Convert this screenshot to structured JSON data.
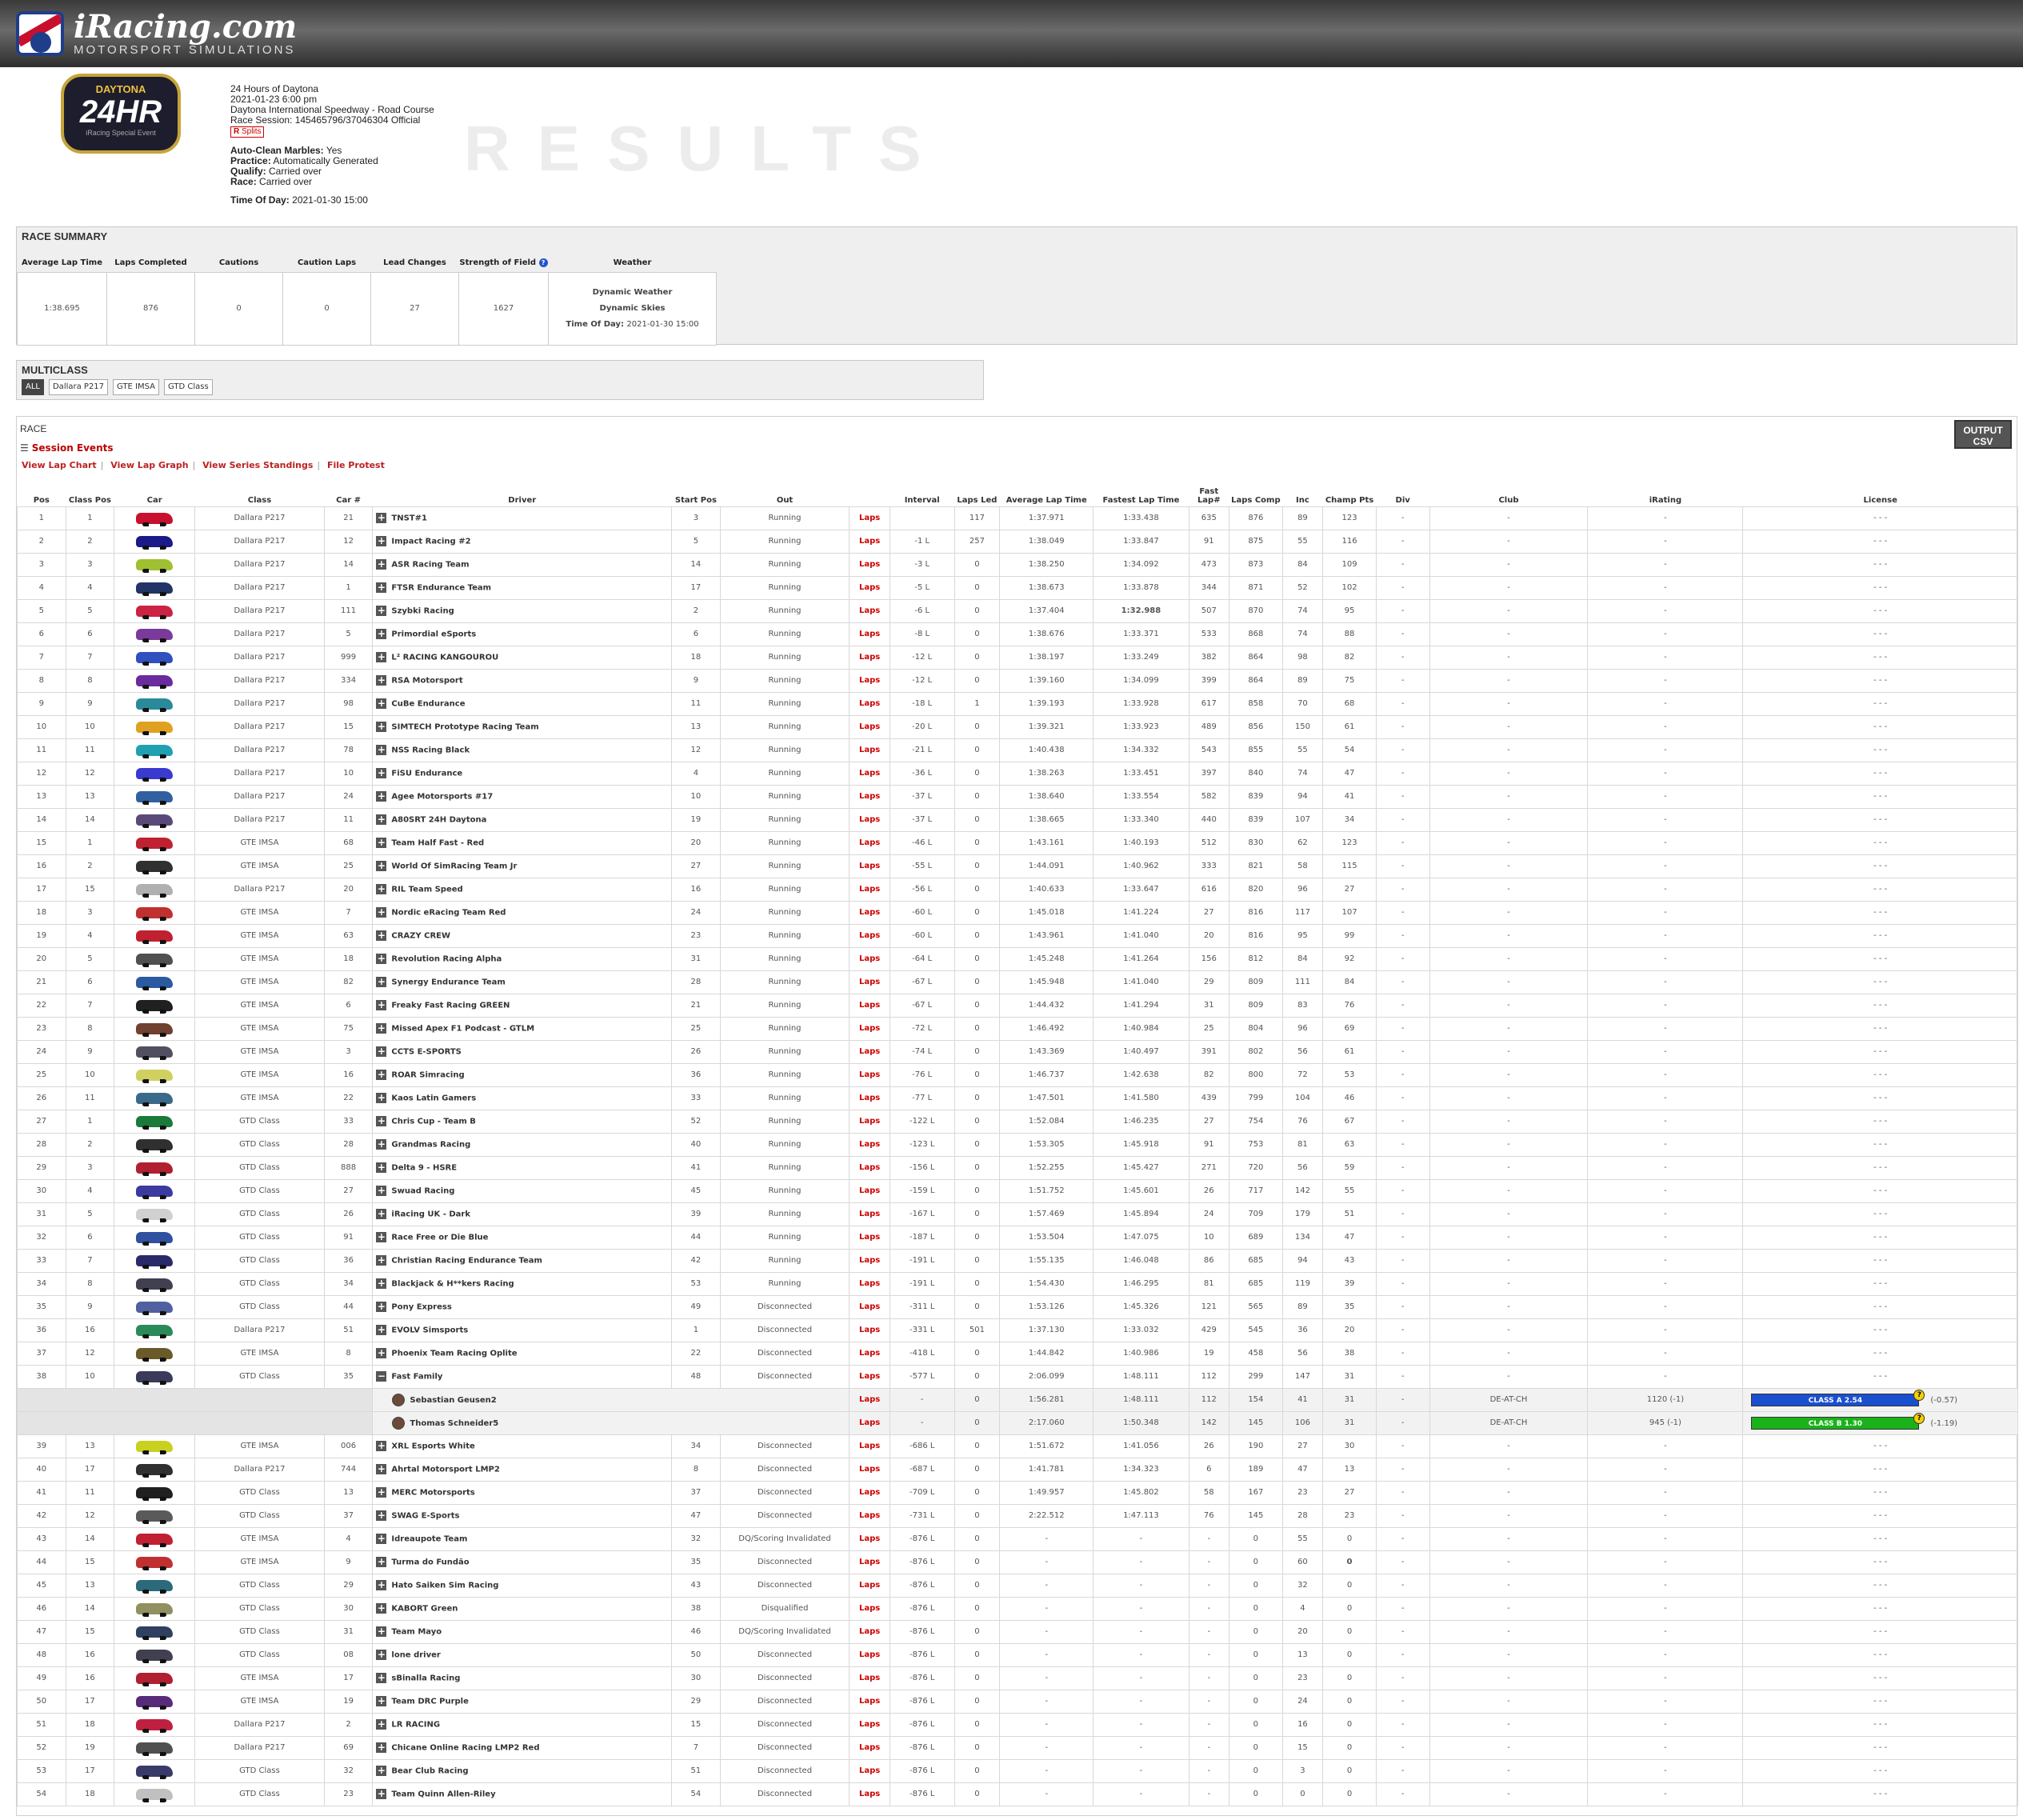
{
  "site": {
    "brand": "iRacing.com",
    "tagline": "MOTORSPORT SIMULATIONS"
  },
  "event": {
    "logo_top": "DAYTONA",
    "logo_main": "24HR",
    "logo_sub": "iRacing Special Event",
    "name": "24 Hours of Daytona",
    "datetime": "2021-01-23 6:00 pm",
    "track": "Daytona International Speedway - Road Course",
    "session": "Race Session: 145465796/37046304 Official",
    "splits": "Splits",
    "auto_clean_label": "Auto-Clean Marbles:",
    "auto_clean": "Yes",
    "practice_label": "Practice:",
    "practice": "Automatically Generated",
    "qualify_label": "Qualify:",
    "qualify": "Carried over",
    "race_label": "Race:",
    "race": "Carried over",
    "tod_label": "Time Of Day:",
    "tod": "2021-01-30 15:00",
    "results_word": "RESULTS"
  },
  "summary": {
    "title": "RACE SUMMARY",
    "headers": [
      "Average Lap Time",
      "Laps Completed",
      "Cautions",
      "Caution Laps",
      "Lead Changes",
      "Strength of Field",
      "Weather"
    ],
    "values": [
      "1:38.695",
      "876",
      "0",
      "0",
      "27",
      "1627"
    ],
    "weather": [
      "Dynamic Weather",
      "Dynamic Skies"
    ],
    "weather_tod_label": "Time Of Day:",
    "weather_tod": "2021-01-30 15:00"
  },
  "multiclass": {
    "title": "MULTICLASS",
    "tabs": [
      "ALL",
      "Dallara P217",
      "GTE IMSA",
      "GTD Class"
    ]
  },
  "race": {
    "title": "RACE",
    "csv": "OUTPUT CSV",
    "session_events": "Session Events",
    "links": [
      "View Lap Chart",
      "View Lap Graph",
      "View Series Standings",
      "File Protest"
    ],
    "headers": [
      "Pos",
      "Class Pos",
      "Car",
      "Class",
      "Car #",
      "Driver",
      "Start Pos",
      "Out",
      "",
      "Interval",
      "Laps Led",
      "Average Lap Time",
      "Fastest Lap Time",
      "Fast Lap#",
      "Laps Comp",
      "Inc",
      "Champ Pts",
      "Div",
      "Club",
      "iRating",
      "License"
    ],
    "laps_label": "Laps",
    "rows": [
      [
        "1",
        "1",
        "#c8102e",
        "Dallara P217",
        "21",
        "TNST#1",
        "3",
        "Running",
        "",
        "117",
        "1:37.971",
        "1:33.438",
        "635",
        "876",
        "89",
        "123"
      ],
      [
        "2",
        "2",
        "#1a1a8a",
        "Dallara P217",
        "12",
        "Impact Racing #2",
        "5",
        "Running",
        "-1 L",
        "257",
        "1:38.049",
        "1:33.847",
        "91",
        "875",
        "55",
        "116"
      ],
      [
        "3",
        "3",
        "#9fc030",
        "Dallara P217",
        "14",
        "ASR Racing Team",
        "14",
        "Running",
        "-3 L",
        "0",
        "1:38.250",
        "1:34.092",
        "473",
        "873",
        "84",
        "109"
      ],
      [
        "4",
        "4",
        "#223366",
        "Dallara P217",
        "1",
        "FTSR Endurance Team",
        "17",
        "Running",
        "-5 L",
        "0",
        "1:38.673",
        "1:33.878",
        "344",
        "871",
        "52",
        "102"
      ],
      [
        "5",
        "5",
        "#cc2244",
        "Dallara P217",
        "111",
        "Szybki Racing",
        "2",
        "Running",
        "-6 L",
        "0",
        "1:37.404",
        "1:32.988",
        "507",
        "870",
        "74",
        "95"
      ],
      [
        "6",
        "6",
        "#7a3a9a",
        "Dallara P217",
        "5",
        "Primordial eSports",
        "6",
        "Running",
        "-8 L",
        "0",
        "1:38.676",
        "1:33.371",
        "533",
        "868",
        "74",
        "88"
      ],
      [
        "7",
        "7",
        "#3050c0",
        "Dallara P217",
        "999",
        "L² RACING KANGOUROU",
        "18",
        "Running",
        "-12 L",
        "0",
        "1:38.197",
        "1:33.249",
        "382",
        "864",
        "98",
        "82"
      ],
      [
        "8",
        "8",
        "#6a2aa0",
        "Dallara P217",
        "334",
        "RSA Motorsport",
        "9",
        "Running",
        "-12 L",
        "0",
        "1:39.160",
        "1:34.099",
        "399",
        "864",
        "89",
        "75"
      ],
      [
        "9",
        "9",
        "#2a8a9a",
        "Dallara P217",
        "98",
        "CuBe Endurance",
        "11",
        "Running",
        "-18 L",
        "1",
        "1:39.193",
        "1:33.928",
        "617",
        "858",
        "70",
        "68"
      ],
      [
        "10",
        "10",
        "#e0a020",
        "Dallara P217",
        "15",
        "SIMTECH Prototype Racing Team",
        "13",
        "Running",
        "-20 L",
        "0",
        "1:39.321",
        "1:33.923",
        "489",
        "856",
        "150",
        "61"
      ],
      [
        "11",
        "11",
        "#20a0b0",
        "Dallara P217",
        "78",
        "NSS Racing Black",
        "12",
        "Running",
        "-21 L",
        "0",
        "1:40.438",
        "1:34.332",
        "543",
        "855",
        "55",
        "54"
      ],
      [
        "12",
        "12",
        "#3a3ad0",
        "Dallara P217",
        "10",
        "FiSU Endurance",
        "4",
        "Running",
        "-36 L",
        "0",
        "1:38.263",
        "1:33.451",
        "397",
        "840",
        "74",
        "47"
      ],
      [
        "13",
        "13",
        "#3060a0",
        "Dallara P217",
        "24",
        "Agee Motorsports #17",
        "10",
        "Running",
        "-37 L",
        "0",
        "1:38.640",
        "1:33.554",
        "582",
        "839",
        "94",
        "41"
      ],
      [
        "14",
        "14",
        "#5a4a7a",
        "Dallara P217",
        "11",
        "A80SRT 24H Daytona",
        "19",
        "Running",
        "-37 L",
        "0",
        "1:38.665",
        "1:33.340",
        "440",
        "839",
        "107",
        "34"
      ],
      [
        "15",
        "1",
        "#c02030",
        "GTE IMSA",
        "68",
        "Team Half Fast - Red",
        "20",
        "Running",
        "-46 L",
        "0",
        "1:43.161",
        "1:40.193",
        "512",
        "830",
        "62",
        "123"
      ],
      [
        "16",
        "2",
        "#303030",
        "GTE IMSA",
        "25",
        "World Of SimRacing Team Jr",
        "27",
        "Running",
        "-55 L",
        "0",
        "1:44.091",
        "1:40.962",
        "333",
        "821",
        "58",
        "115"
      ],
      [
        "17",
        "15",
        "#b0b0b0",
        "Dallara P217",
        "20",
        "RIL Team Speed",
        "16",
        "Running",
        "-56 L",
        "0",
        "1:40.633",
        "1:33.647",
        "616",
        "820",
        "96",
        "27"
      ],
      [
        "18",
        "3",
        "#c03030",
        "GTE IMSA",
        "7",
        "Nordic eRacing Team Red",
        "24",
        "Running",
        "-60 L",
        "0",
        "1:45.018",
        "1:41.224",
        "27",
        "816",
        "117",
        "107"
      ],
      [
        "19",
        "4",
        "#c02030",
        "GTE IMSA",
        "63",
        "CRAZY CREW",
        "23",
        "Running",
        "-60 L",
        "0",
        "1:43.961",
        "1:41.040",
        "20",
        "816",
        "95",
        "99"
      ],
      [
        "20",
        "5",
        "#505050",
        "GTE IMSA",
        "18",
        "Revolution Racing Alpha",
        "31",
        "Running",
        "-64 L",
        "0",
        "1:45.248",
        "1:41.264",
        "156",
        "812",
        "84",
        "92"
      ],
      [
        "21",
        "6",
        "#2a5aa0",
        "GTE IMSA",
        "82",
        "Synergy Endurance Team",
        "28",
        "Running",
        "-67 L",
        "0",
        "1:45.948",
        "1:41.040",
        "29",
        "809",
        "111",
        "84"
      ],
      [
        "22",
        "7",
        "#202020",
        "GTE IMSA",
        "6",
        "Freaky Fast Racing GREEN",
        "21",
        "Running",
        "-67 L",
        "0",
        "1:44.432",
        "1:41.294",
        "31",
        "809",
        "83",
        "76"
      ],
      [
        "23",
        "8",
        "#704030",
        "GTE IMSA",
        "75",
        "Missed Apex F1 Podcast - GTLM",
        "25",
        "Running",
        "-72 L",
        "0",
        "1:46.492",
        "1:40.984",
        "25",
        "804",
        "96",
        "69"
      ],
      [
        "24",
        "9",
        "#505060",
        "GTE IMSA",
        "3",
        "CCTS E-SPORTS",
        "26",
        "Running",
        "-74 L",
        "0",
        "1:43.369",
        "1:40.497",
        "391",
        "802",
        "56",
        "61"
      ],
      [
        "25",
        "10",
        "#d0d060",
        "GTE IMSA",
        "16",
        "ROAR Simracing",
        "36",
        "Running",
        "-76 L",
        "0",
        "1:46.737",
        "1:42.638",
        "82",
        "800",
        "72",
        "53"
      ],
      [
        "26",
        "11",
        "#3a6a8a",
        "GTE IMSA",
        "22",
        "Kaos Latin Gamers",
        "33",
        "Running",
        "-77 L",
        "0",
        "1:47.501",
        "1:41.580",
        "439",
        "799",
        "104",
        "46"
      ],
      [
        "27",
        "1",
        "#1a7a3a",
        "GTD Class",
        "33",
        "Chris Cup - Team B",
        "52",
        "Running",
        "-122 L",
        "0",
        "1:52.084",
        "1:46.235",
        "27",
        "754",
        "76",
        "67"
      ],
      [
        "28",
        "2",
        "#303030",
        "GTD Class",
        "28",
        "Grandmas Racing",
        "40",
        "Running",
        "-123 L",
        "0",
        "1:53.305",
        "1:45.918",
        "91",
        "753",
        "81",
        "63"
      ],
      [
        "29",
        "3",
        "#b02030",
        "GTD Class",
        "888",
        "Delta 9 - HSRE",
        "41",
        "Running",
        "-156 L",
        "0",
        "1:52.255",
        "1:45.427",
        "271",
        "720",
        "56",
        "59"
      ],
      [
        "30",
        "4",
        "#3a3aa0",
        "GTD Class",
        "27",
        "Swuad Racing",
        "45",
        "Running",
        "-159 L",
        "0",
        "1:51.752",
        "1:45.601",
        "26",
        "717",
        "142",
        "55"
      ],
      [
        "31",
        "5",
        "#d0d0d0",
        "GTD Class",
        "26",
        "iRacing UK - Dark",
        "39",
        "Running",
        "-167 L",
        "0",
        "1:57.469",
        "1:45.894",
        "24",
        "709",
        "179",
        "51"
      ],
      [
        "32",
        "6",
        "#3050a0",
        "GTD Class",
        "91",
        "Race Free or Die Blue",
        "44",
        "Running",
        "-187 L",
        "0",
        "1:53.504",
        "1:47.075",
        "10",
        "689",
        "134",
        "47"
      ],
      [
        "33",
        "7",
        "#2a2a6a",
        "GTD Class",
        "36",
        "Christian Racing Endurance Team",
        "42",
        "Running",
        "-191 L",
        "0",
        "1:55.135",
        "1:46.048",
        "86",
        "685",
        "94",
        "43"
      ],
      [
        "34",
        "8",
        "#404050",
        "GTD Class",
        "34",
        "Blackjack & H**kers Racing",
        "53",
        "Running",
        "-191 L",
        "0",
        "1:54.430",
        "1:46.295",
        "81",
        "685",
        "119",
        "39"
      ],
      [
        "35",
        "9",
        "#5060a0",
        "GTD Class",
        "44",
        "Pony Express",
        "49",
        "Disconnected",
        "-311 L",
        "0",
        "1:53.126",
        "1:45.326",
        "121",
        "565",
        "89",
        "35"
      ],
      [
        "36",
        "16",
        "#2a8a5a",
        "Dallara P217",
        "51",
        "EVOLV Simsports",
        "1",
        "Disconnected",
        "-331 L",
        "501",
        "1:37.130",
        "1:33.032",
        "429",
        "545",
        "36",
        "20"
      ],
      [
        "37",
        "12",
        "#6a5a2a",
        "GTE IMSA",
        "8",
        "Phoenix Team Racing Oplite",
        "22",
        "Disconnected",
        "-418 L",
        "0",
        "1:44.842",
        "1:40.986",
        "19",
        "458",
        "56",
        "38"
      ],
      [
        "38",
        "10",
        "#3a3a5a",
        "GTD Class",
        "35",
        "Fast Family",
        "48",
        "Disconnected",
        "-577 L",
        "0",
        "2:06.099",
        "1:48.111",
        "112",
        "299",
        "147",
        "31"
      ]
    ],
    "sub_rows": [
      {
        "name": "Sebastian Geusen2",
        "interval": "-",
        "led": "0",
        "avg": "1:56.281",
        "fast": "1:48.111",
        "lapno": "112",
        "comp": "154",
        "inc": "41",
        "pts": "31",
        "club": "DE-AT-CH",
        "irating": "1120 (-1)",
        "license": "CLASS A 2.54",
        "lic_color": "#1a4fd0",
        "lic_delta": "(-0.57)"
      },
      {
        "name": "Thomas Schneider5",
        "interval": "-",
        "led": "0",
        "avg": "2:17.060",
        "fast": "1:50.348",
        "lapno": "142",
        "comp": "145",
        "inc": "106",
        "pts": "31",
        "club": "DE-AT-CH",
        "irating": "945 (-1)",
        "license": "CLASS B 1.30",
        "lic_color": "#19b319",
        "lic_delta": "(-1.19)"
      }
    ],
    "rows2": [
      [
        "39",
        "13",
        "#c8d020",
        "GTE IMSA",
        "006",
        "XRL Esports White",
        "34",
        "Disconnected",
        "-686 L",
        "0",
        "1:51.672",
        "1:41.056",
        "26",
        "190",
        "27",
        "30"
      ],
      [
        "40",
        "17",
        "#303030",
        "Dallara P217",
        "744",
        "Ahrtal Motorsport LMP2",
        "8",
        "Disconnected",
        "-687 L",
        "0",
        "1:41.781",
        "1:34.323",
        "6",
        "189",
        "47",
        "13"
      ],
      [
        "41",
        "11",
        "#202020",
        "GTD Class",
        "13",
        "MERC Motorsports",
        "37",
        "Disconnected",
        "-709 L",
        "0",
        "1:49.957",
        "1:45.802",
        "58",
        "167",
        "23",
        "27"
      ],
      [
        "42",
        "12",
        "#5a5a5a",
        "GTD Class",
        "37",
        "SWAG E-Sports",
        "47",
        "Disconnected",
        "-731 L",
        "0",
        "2:22.512",
        "1:47.113",
        "76",
        "145",
        "28",
        "23"
      ],
      [
        "43",
        "14",
        "#c02030",
        "GTE IMSA",
        "4",
        "Idreaupote Team",
        "32",
        "DQ/Scoring Invalidated",
        "-876 L",
        "0",
        "-",
        "-",
        "-",
        "0",
        "55",
        "0"
      ],
      [
        "44",
        "15",
        "#c03030",
        "GTE IMSA",
        "9",
        "Turma do Fundão",
        "35",
        "Disconnected",
        "-876 L",
        "0",
        "-",
        "-",
        "-",
        "0",
        "60",
        "0"
      ],
      [
        "45",
        "13",
        "#2a6a7a",
        "GTD Class",
        "29",
        "Hato Saiken Sim Racing",
        "43",
        "Disconnected",
        "-876 L",
        "0",
        "-",
        "-",
        "-",
        "0",
        "32",
        "0"
      ],
      [
        "46",
        "14",
        "#909060",
        "GTD Class",
        "30",
        "KABORT Green",
        "38",
        "Disqualified",
        "-876 L",
        "0",
        "-",
        "-",
        "-",
        "0",
        "4",
        "0"
      ],
      [
        "47",
        "15",
        "#304060",
        "GTD Class",
        "31",
        "Team Mayo",
        "46",
        "DQ/Scoring Invalidated",
        "-876 L",
        "0",
        "-",
        "-",
        "-",
        "0",
        "20",
        "0"
      ],
      [
        "48",
        "16",
        "#404050",
        "GTD Class",
        "08",
        "lone driver",
        "50",
        "Disconnected",
        "-876 L",
        "0",
        "-",
        "-",
        "-",
        "0",
        "13",
        "0"
      ],
      [
        "49",
        "16",
        "#b02030",
        "GTE IMSA",
        "17",
        "sBinalla Racing",
        "30",
        "Disconnected",
        "-876 L",
        "0",
        "-",
        "-",
        "-",
        "0",
        "23",
        "0"
      ],
      [
        "50",
        "17",
        "#5a2a7a",
        "GTE IMSA",
        "19",
        "Team DRC Purple",
        "29",
        "Disconnected",
        "-876 L",
        "0",
        "-",
        "-",
        "-",
        "0",
        "24",
        "0"
      ],
      [
        "51",
        "18",
        "#c02040",
        "Dallara P217",
        "2",
        "LR RACING",
        "15",
        "Disconnected",
        "-876 L",
        "0",
        "-",
        "-",
        "-",
        "0",
        "16",
        "0"
      ],
      [
        "52",
        "19",
        "#505050",
        "Dallara P217",
        "69",
        "Chicane Online Racing LMP2 Red",
        "7",
        "Disconnected",
        "-876 L",
        "0",
        "-",
        "-",
        "-",
        "0",
        "15",
        "0"
      ],
      [
        "53",
        "17",
        "#3a3a6a",
        "GTD Class",
        "32",
        "Bear Club Racing",
        "51",
        "Disconnected",
        "-876 L",
        "0",
        "-",
        "-",
        "-",
        "0",
        "3",
        "0"
      ],
      [
        "54",
        "18",
        "#c0c0c0",
        "GTD Class",
        "23",
        "Team Quinn Allen-Riley",
        "54",
        "Disconnected",
        "-876 L",
        "0",
        "-",
        "-",
        "-",
        "0",
        "0",
        "0"
      ]
    ],
    "dash": "-",
    "license_dash": "- - -"
  }
}
